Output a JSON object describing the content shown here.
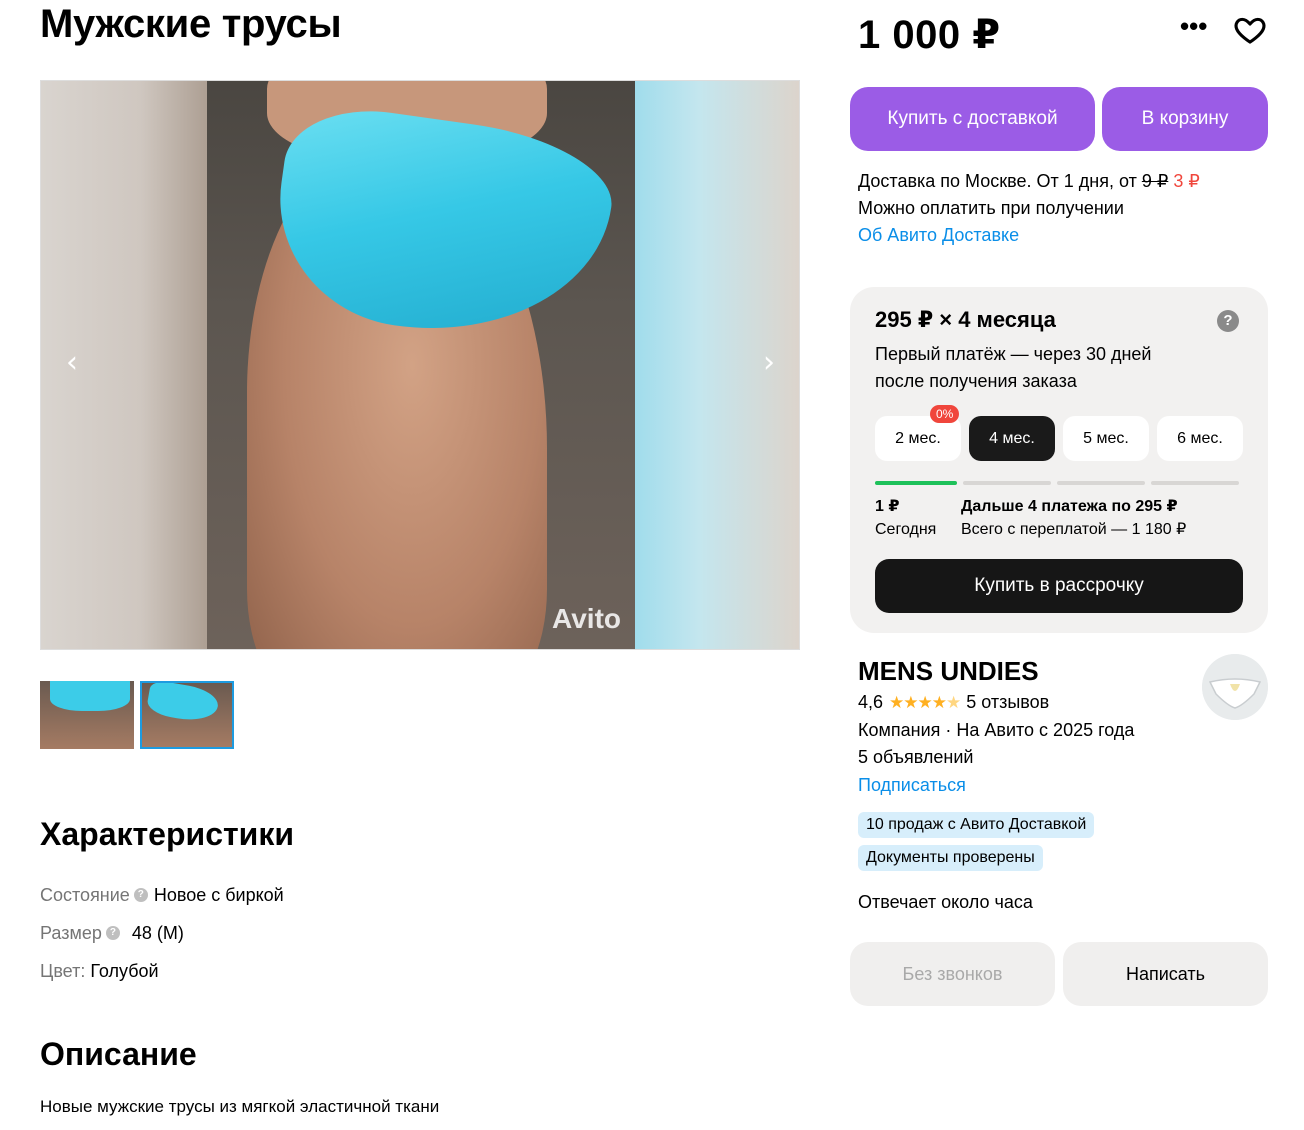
{
  "product": {
    "title": "Мужские трусы",
    "price": "1 000 ₽",
    "watermark": "Avito"
  },
  "actions": {
    "buy_delivery": "Купить с доставкой",
    "to_cart": "В корзину"
  },
  "delivery": {
    "text": "Доставка по Москве. От 1 дня, от ",
    "old_price": "9 ₽",
    "new_price": "3 ₽",
    "payment": "Можно оплатить при получении",
    "about_link": "Об Авито Доставке"
  },
  "installment": {
    "title": "295 ₽ × 4 месяца",
    "subtitle": "Первый платёж — через 30 дней после получения заказа",
    "help": "?",
    "badge": "0%",
    "months": [
      "2 мес.",
      "4 мес.",
      "5 мес.",
      "6 мес."
    ],
    "selected_month": "4 мес.",
    "today_amount": "1 ₽",
    "today_label": "Сегодня",
    "later_title": "Дальше 4 платежа по 295 ₽",
    "later_total": "Всего с переплатой — 1 180 ₽",
    "buy_button": "Купить в рассрочку"
  },
  "seller": {
    "name": "MENS UNDIES",
    "rating": "4,6",
    "stars": 4.6,
    "reviews": "5 отзывов",
    "type": "Компания · На Авито с 2025 года",
    "listings": "5 объявлений",
    "subscribe": "Подписаться",
    "tags": [
      "10 продаж с Авито Доставкой",
      "Документы проверены"
    ],
    "response": "Отвечает около часа",
    "no_calls": "Без звонков",
    "write": "Написать"
  },
  "characteristics": {
    "heading": "Характеристики",
    "rows": [
      {
        "key": "Состояние",
        "value": "Новое с биркой",
        "help": "?"
      },
      {
        "key": "Размер",
        "value": "48 (M)",
        "help": "?"
      },
      {
        "key": "Цвет:",
        "value": "Голубой"
      }
    ]
  },
  "description": {
    "heading": "Описание",
    "text": "Новые мужские трусы из мягкой эластичной ткани"
  },
  "icons": {
    "more": "more-icon",
    "favorite": "heart-icon",
    "prev": "chevron-left-icon",
    "next": "chevron-right-icon"
  },
  "colors": {
    "accent_purple": "#9b5ce6",
    "link_blue": "#0a8ee8",
    "price_red": "#f0463c",
    "progress_green": "#1ec15a"
  }
}
